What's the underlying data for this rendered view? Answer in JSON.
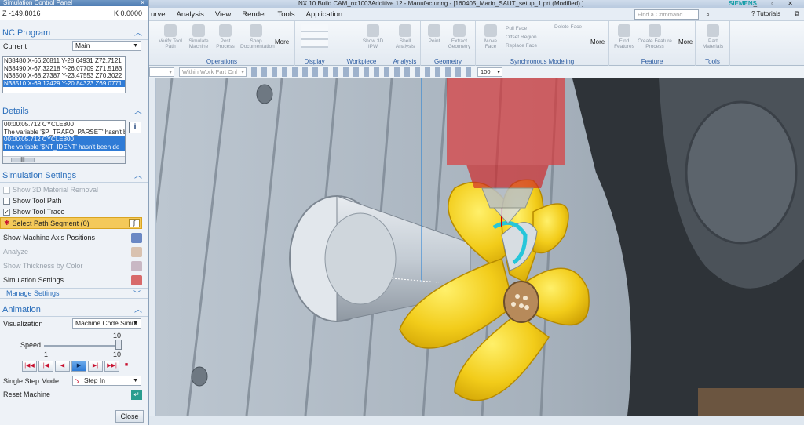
{
  "panel": {
    "title": "Simulation Control Panel",
    "coord_left": "Z -149.8016",
    "coord_right": "K 0.0000",
    "nc_program": {
      "header": "NC Program",
      "current_label": "Current",
      "current_value": "Main",
      "lines": [
        "N38480 X-66.26811 Y-28.64931 Z72.7121",
        "N38490 X-67.32218 Y-26.07709 Z71.5183",
        "N38500 X-68.27387 Y-23.47553 Z70.3022",
        "N38510 X-69.12429 Y-20.84323 Z69.0771"
      ],
      "selected_index": 3
    },
    "details": {
      "header": "Details",
      "lines": [
        "00:00:05.712 CYCLE800",
        "The variable '$P_TRAFO_PARSET' hasn't b",
        "00:00:05.712 CYCLE800",
        "The variable '$NT_IDENT' hasn't been de"
      ],
      "selected_indices": [
        2,
        3
      ]
    },
    "sim_settings": {
      "header": "Simulation Settings",
      "show_3d": "Show 3D Material Removal",
      "show_tool_path": "Show Tool Path",
      "show_tool_trace": "Show Tool Trace",
      "select_path_segment": "Select Path Segment (0)",
      "show_machine_axis": "Show Machine Axis Positions",
      "analyze": "Analyze",
      "show_thickness": "Show Thickness by Color",
      "simulation_settings": "Simulation Settings",
      "manage_settings": "Manage Settings"
    },
    "animation": {
      "header": "Animation",
      "visualization_label": "Visualization",
      "visualization_value": "Machine Code Simul",
      "speed_label": "Speed",
      "speed_min": "1",
      "speed_max": "10",
      "speed_value": "10",
      "speed_fraction": 1.0,
      "single_step_label": "Single Step Mode",
      "single_step_value": "Step In",
      "reset_label": "Reset Machine",
      "close_label": "Close"
    }
  },
  "window": {
    "title": "NX 10  Build CAM_nx1003Additive.12 - Manufacturing - [160405_Marin_SAUT_setup_1.prt (Modified) ]",
    "brand": "SIEMENS"
  },
  "menu": {
    "items": [
      "urve",
      "Analysis",
      "View",
      "Render",
      "Tools",
      "Application"
    ],
    "find_placeholder": "Find a Command",
    "tutorials": "Tutorials"
  },
  "ribbon": {
    "groups": [
      {
        "label": "Operations",
        "buttons": [
          "Verify Tool Path",
          "Simulate Machine",
          "Post Process",
          "Shop Documentation"
        ]
      },
      {
        "label": "Display"
      },
      {
        "label": "Workpiece",
        "buttons": [
          "Show 3D IPW"
        ]
      },
      {
        "label": "Analysis",
        "buttons": [
          "Shell Analysis"
        ]
      },
      {
        "label": "Geometry",
        "buttons": [
          "Point",
          "Extract Geometry"
        ]
      },
      {
        "label": "Synchronous Modeling",
        "buttons": [
          "Move Face",
          "Pull Face",
          "Offset Region",
          "Replace Face",
          "Delete Face"
        ]
      },
      {
        "label": "Feature",
        "buttons": [
          "Find Features",
          "Create Feature Process"
        ]
      },
      {
        "label": "Tools",
        "buttons": [
          "Part Materials"
        ]
      }
    ],
    "more": "More"
  },
  "toolbar": {
    "filter_value": "",
    "scope_value": "Within Work Part Onl",
    "zoom_value": "100"
  },
  "colors": {
    "accent": "#2a6ebb",
    "selection": "#2f7bd6",
    "propeller": "#f2cc1a",
    "spindle": "#e03030",
    "highlight_segment": "#f4c95a"
  }
}
